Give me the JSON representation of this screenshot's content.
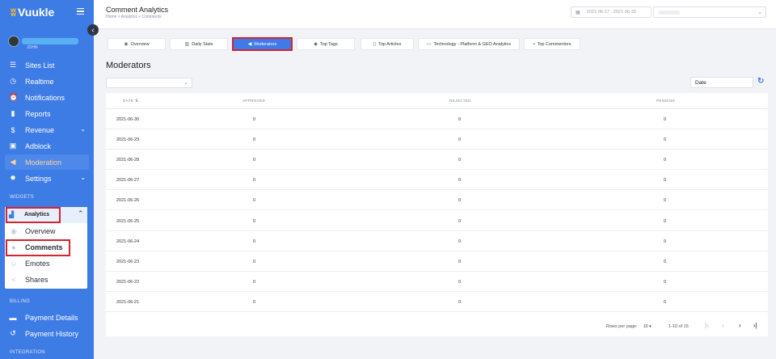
{
  "sidebar": {
    "logo": "Vuukle",
    "user_sub": "JOHN",
    "items": [
      {
        "label": "Sites List",
        "icon": "list-icon"
      },
      {
        "label": "Realtime",
        "icon": "clock-icon"
      },
      {
        "label": "Notifications",
        "icon": "alarm-clock-icon"
      },
      {
        "label": "Reports",
        "icon": "book-icon"
      },
      {
        "label": "Revenue",
        "icon": "dollar-icon"
      },
      {
        "label": "Adblock",
        "icon": "ad-icon"
      },
      {
        "label": "Moderation",
        "icon": "megaphone-icon"
      },
      {
        "label": "Settings",
        "icon": "gear-icon"
      }
    ],
    "widgets_label": "WIDGETS",
    "analytics_label": "Analytics",
    "widget_items": [
      {
        "label": "Overview",
        "icon": "eye-icon"
      },
      {
        "label": "Comments",
        "icon": "comments-icon"
      },
      {
        "label": "Emotes",
        "icon": "emote-icon"
      },
      {
        "label": "Shares",
        "icon": "share-icon"
      }
    ],
    "billing_label": "BILLING",
    "billing_items": [
      {
        "label": "Payment Details",
        "icon": "credit-card-icon"
      },
      {
        "label": "Payment History",
        "icon": "history-icon"
      }
    ],
    "integration_label": "INTEGRATION"
  },
  "header": {
    "title": "Comment Analytics",
    "breadcrumb": "Home  >  Analytics  >  Comments",
    "date_range": "2021-06-17 - 2021-06-30"
  },
  "tabs": [
    {
      "label": "Overview",
      "icon": "eye-icon"
    },
    {
      "label": "Daily Stats",
      "icon": "bar-chart-icon"
    },
    {
      "label": "Moderators",
      "icon": "megaphone-icon"
    },
    {
      "label": "Top Tags",
      "icon": "tags-icon"
    },
    {
      "label": "Top Articles",
      "icon": "file-icon"
    },
    {
      "label": "Technology - Platform & GEO Analytics",
      "icon": "laptop-icon"
    },
    {
      "label": "Top Commenters",
      "icon": "comment-icon"
    }
  ],
  "main": {
    "heading": "Moderators",
    "sort_field": "Date",
    "columns": [
      "DATE",
      "APPROVED",
      "REJECTED",
      "PENDING"
    ],
    "rows": [
      {
        "date": "2021-06-30",
        "approved": "0",
        "rejected": "0",
        "pending": "0"
      },
      {
        "date": "2021-06-29",
        "approved": "0",
        "rejected": "0",
        "pending": "0"
      },
      {
        "date": "2021-06-28",
        "approved": "0",
        "rejected": "0",
        "pending": "0"
      },
      {
        "date": "2021-06-27",
        "approved": "0",
        "rejected": "0",
        "pending": "0"
      },
      {
        "date": "2021-06-26",
        "approved": "0",
        "rejected": "0",
        "pending": "0"
      },
      {
        "date": "2021-06-25",
        "approved": "0",
        "rejected": "0",
        "pending": "0"
      },
      {
        "date": "2021-06-24",
        "approved": "0",
        "rejected": "0",
        "pending": "0"
      },
      {
        "date": "2021-06-23",
        "approved": "0",
        "rejected": "0",
        "pending": "0"
      },
      {
        "date": "2021-06-22",
        "approved": "0",
        "rejected": "0",
        "pending": "0"
      },
      {
        "date": "2021-06-21",
        "approved": "0",
        "rejected": "0",
        "pending": "0"
      }
    ],
    "rows_per_page_label": "Rows per page:",
    "rows_per_page": "10",
    "page_range": "1-10 of 15"
  },
  "colors": {
    "sidebar": "#3d7be5",
    "accent": "#3f7be8",
    "highlight": "#d5232f"
  }
}
